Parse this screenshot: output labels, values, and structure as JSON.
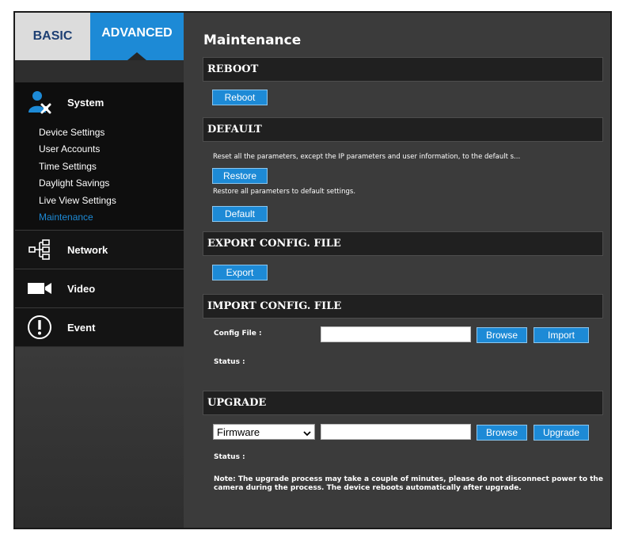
{
  "tabs": {
    "basic": "BASIC",
    "advanced": "ADVANCED"
  },
  "sidebar": {
    "system": "System",
    "items": [
      "Device Settings",
      "User Accounts",
      "Time Settings",
      "Daylight Savings",
      "Live View Settings",
      "Maintenance"
    ],
    "network": "Network",
    "video": "Video",
    "event": "Event"
  },
  "page": {
    "title": "Maintenance"
  },
  "reboot": {
    "header": "REBOOT",
    "button": "Reboot"
  },
  "default": {
    "header": "DEFAULT",
    "restore_desc": "Reset all the parameters, except the IP parameters and user information, to the default s...",
    "restore_button": "Restore",
    "default_desc": "Restore all parameters to default settings.",
    "default_button": "Default"
  },
  "export": {
    "header": "EXPORT CONFIG. FILE",
    "button": "Export"
  },
  "import": {
    "header": "IMPORT CONFIG. FILE",
    "config_label": "Config File :",
    "config_value": "",
    "browse": "Browse",
    "import_button": "Import",
    "status_label": "Status :"
  },
  "upgrade": {
    "header": "UPGRADE",
    "type_selected": "Firmware",
    "file_value": "",
    "browse": "Browse",
    "upgrade_button": "Upgrade",
    "status_label": "Status :",
    "note": "Note: The upgrade process may take a couple of minutes, please do not disconnect power to the camera during the process. The device reboots automatically after upgrade."
  },
  "colors": {
    "accent": "#1d8ad6",
    "panel": "#3b3b3b",
    "sidebar": "#2e2e2e",
    "header": "#202020"
  },
  "icons": {
    "system": "user-gear-icon",
    "network": "network-icon",
    "video": "camera-icon",
    "event": "alert-icon",
    "select": "chevron-down-icon"
  }
}
